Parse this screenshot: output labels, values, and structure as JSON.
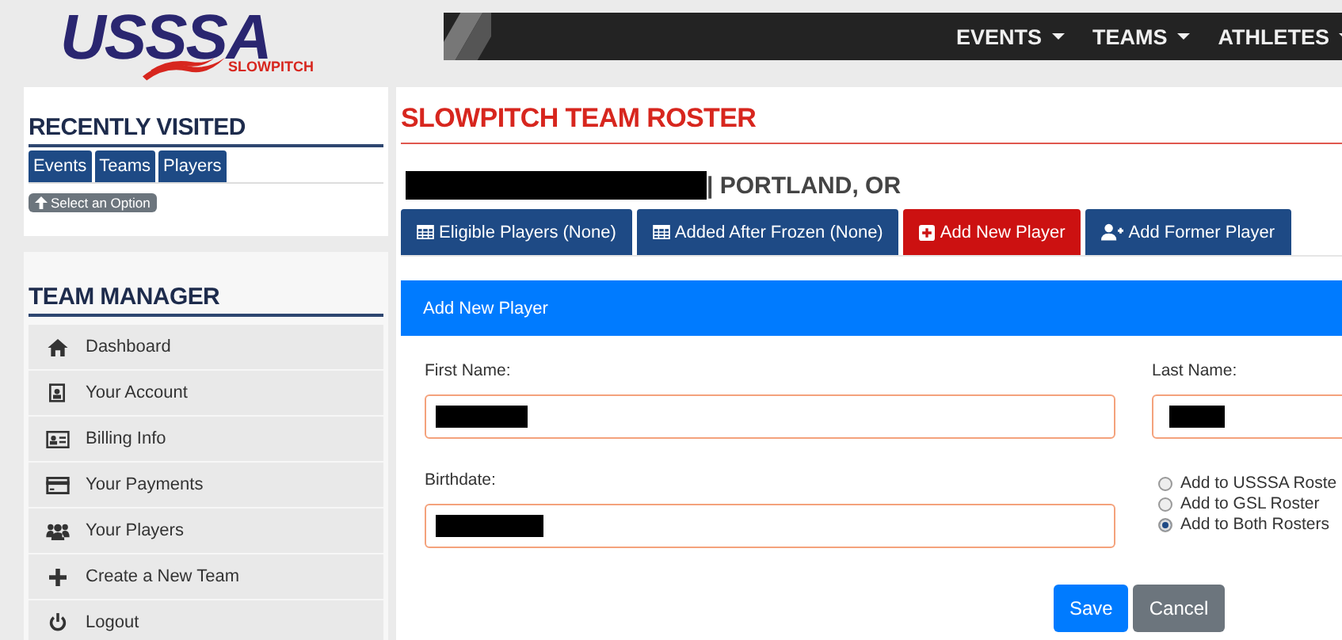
{
  "header": {
    "logo": {
      "name": "USSSA",
      "sub": "SLOWPITCH"
    },
    "nav": [
      {
        "label": "EVENTS"
      },
      {
        "label": "TEAMS"
      },
      {
        "label": "ATHLETES"
      }
    ]
  },
  "sidebar": {
    "recent": {
      "title": "RECENTLY VISITED",
      "tabs": [
        {
          "label": "Events",
          "selected": false
        },
        {
          "label": "Teams",
          "selected": false
        },
        {
          "label": "Players",
          "selected": false
        }
      ],
      "hint": "Select an Option"
    },
    "manager": {
      "title": "TEAM MANAGER",
      "items": [
        {
          "label": "Dashboard"
        },
        {
          "label": "Your Account"
        },
        {
          "label": "Billing Info"
        },
        {
          "label": "Your Payments"
        },
        {
          "label": "Your Players"
        },
        {
          "label": "Create a New Team"
        },
        {
          "label": "Logout"
        }
      ]
    }
  },
  "main": {
    "title": "SLOWPITCH TEAM ROSTER",
    "team": {
      "location": "| PORTLAND, OR"
    },
    "tabs": [
      {
        "label": "Eligible Players (None)",
        "selected": false
      },
      {
        "label": "Added After Frozen (None)",
        "selected": false
      },
      {
        "label": "Add New Player",
        "selected": true
      },
      {
        "label": "Add Former Player",
        "selected": false
      }
    ],
    "form": {
      "title": "Add New Player",
      "fields": [
        {
          "label": "First Name:"
        },
        {
          "label": "Last Name:"
        },
        {
          "label": "Birthdate:"
        }
      ],
      "rosters": [
        {
          "label": "Add to USSSA Roste",
          "selected": false
        },
        {
          "label": "Add to GSL Roster",
          "selected": false
        },
        {
          "label": "Add to Both Rosters",
          "selected": true
        }
      ],
      "buttons": [
        {
          "label": "Save",
          "kind": "primary"
        },
        {
          "label": "Cancel",
          "kind": "secondary"
        }
      ]
    }
  }
}
